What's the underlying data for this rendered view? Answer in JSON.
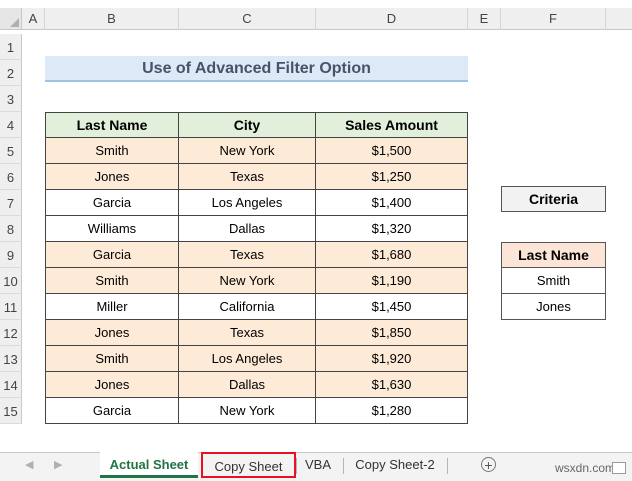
{
  "columns": [
    "A",
    "B",
    "C",
    "D",
    "E",
    "F"
  ],
  "rows": [
    "1",
    "2",
    "3",
    "4",
    "5",
    "6",
    "7",
    "8",
    "9",
    "10",
    "11",
    "12",
    "13",
    "14",
    "15"
  ],
  "title": "Use of Advanced Filter Option",
  "table": {
    "headers": [
      "Last Name",
      "City",
      "Sales Amount"
    ],
    "rows": [
      [
        "Smith",
        "New York",
        "$1,500"
      ],
      [
        "Jones",
        "Texas",
        "$1,250"
      ],
      [
        "Garcia",
        "Los Angeles",
        "$1,400"
      ],
      [
        "Williams",
        "Dallas",
        "$1,320"
      ],
      [
        "Garcia",
        "Texas",
        "$1,680"
      ],
      [
        "Smith",
        "New York",
        "$1,190"
      ],
      [
        "Miller",
        "California",
        "$1,450"
      ],
      [
        "Jones",
        "Texas",
        "$1,850"
      ],
      [
        "Smith",
        "Los Angeles",
        "$1,920"
      ],
      [
        "Jones",
        "Dallas",
        "$1,630"
      ],
      [
        "Garcia",
        "New York",
        "$1,280"
      ]
    ],
    "highlighted_rows": [
      0,
      1,
      4,
      5,
      7,
      8,
      9
    ]
  },
  "criteria": {
    "label": "Criteria",
    "header": "Last Name",
    "values": [
      "Smith",
      "Jones"
    ]
  },
  "tabs": [
    "Actual Sheet",
    "Copy Sheet",
    "VBA",
    "Copy Sheet-2"
  ],
  "active_tab": "Actual Sheet",
  "highlighted_tab": "Copy Sheet",
  "nav_icons": [
    "prev-sheet-arrow",
    "next-sheet-arrow",
    "add-sheet-icon"
  ],
  "watermark": "wsxdn.com",
  "colors": {
    "header_green": "#e2efda",
    "row_highlight": "#fdebd7",
    "title_fill": "#dde9f6",
    "criteria_header": "#fce4d6",
    "active_tab_text": "#217346",
    "tab_outline": "#e81123"
  }
}
